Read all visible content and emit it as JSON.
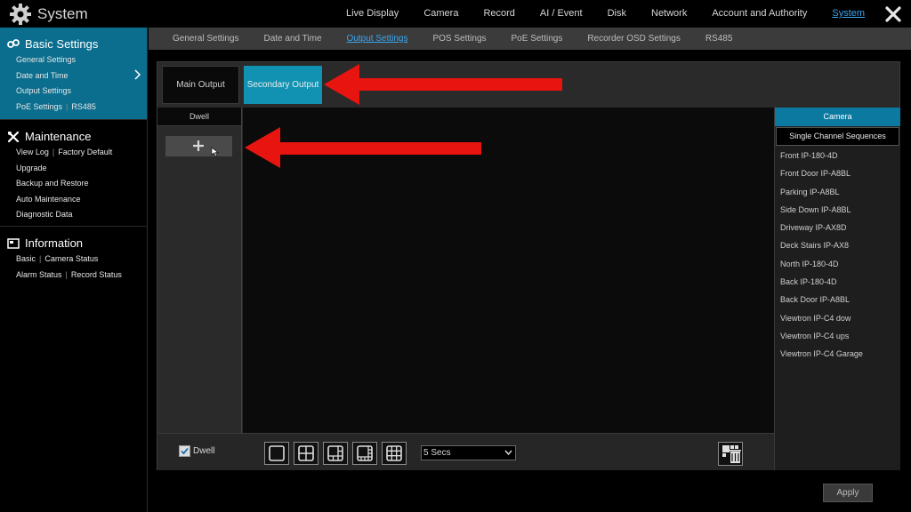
{
  "header": {
    "title": "System",
    "nav": [
      "Live Display",
      "Camera",
      "Record",
      "AI / Event",
      "Disk",
      "Network",
      "Account and Authority",
      "System"
    ],
    "active_nav": "System"
  },
  "sidebar": {
    "basic": {
      "title": "Basic Settings",
      "items": [
        "General Settings",
        "Date and Time",
        "Output Settings"
      ],
      "last_row": [
        "PoE Settings",
        "RS485"
      ]
    },
    "maintenance": {
      "title": "Maintenance",
      "row1": [
        "View Log",
        "Factory Default"
      ],
      "items": [
        "Upgrade",
        "Backup and Restore",
        "Auto Maintenance",
        "Diagnostic Data"
      ]
    },
    "information": {
      "title": "Information",
      "row1": [
        "Basic",
        "Camera Status"
      ],
      "row2": [
        "Alarm Status",
        "Record Status"
      ]
    }
  },
  "subtabs": [
    "General Settings",
    "Date and Time",
    "Output Settings",
    "POS Settings",
    "PoE Settings",
    "Recorder OSD Settings",
    "RS485"
  ],
  "active_subtab": "Output Settings",
  "output": {
    "main_label": "Main Output",
    "secondary_label": "Secondary Output",
    "dwell_header": "Dwell",
    "dwell_checkbox": "Dwell",
    "dwell_checked": true,
    "interval": "5 Secs"
  },
  "camera_panel": {
    "header": "Camera",
    "sequence_tab": "Single Channel Sequences",
    "cameras": [
      "Front IP-180-4D",
      "Front Door IP-A8BL",
      "Parking IP-A8BL",
      "Side Down IP-A8BL",
      "Driveway IP-AX8D",
      "Deck Stairs IP-AX8",
      "North IP-180-4D",
      "Back IP-180-4D",
      "Back Door IP-A8BL",
      "Viewtron IP-C4 dow",
      "Viewtron IP-C4 ups",
      "Viewtron IP-C4 Garage"
    ]
  },
  "apply_label": "Apply",
  "colors": {
    "accent": "#1192b3",
    "sidebar_active": "#0c6e8e",
    "link_active": "#3aa6f0",
    "arrow": "#e8140f"
  }
}
